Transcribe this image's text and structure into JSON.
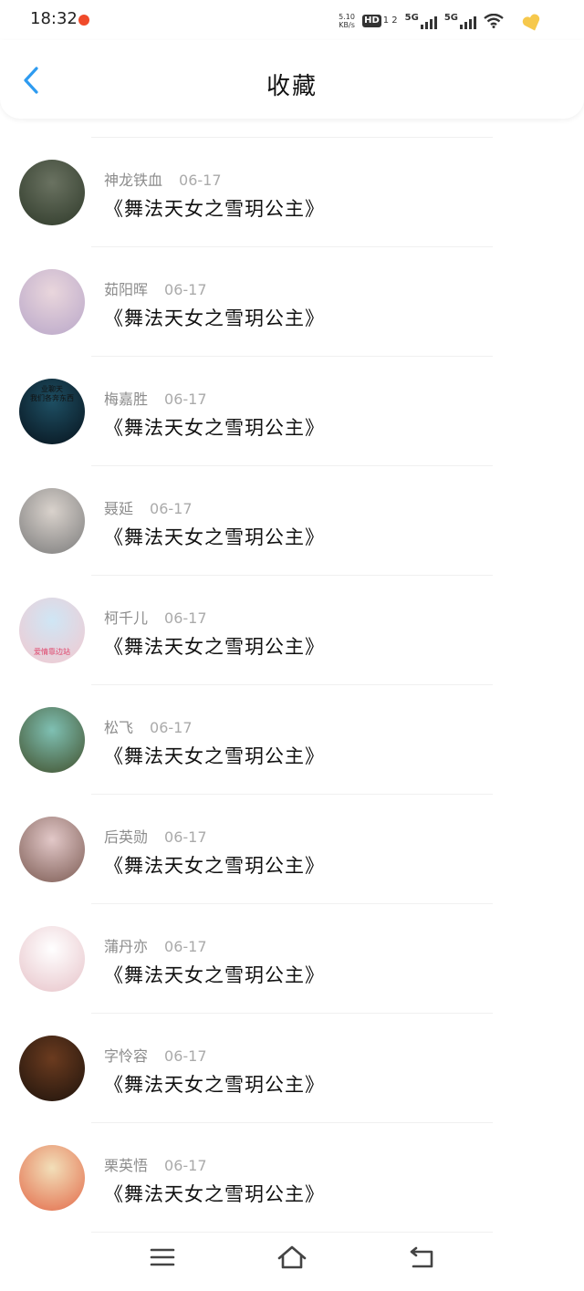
{
  "status_bar": {
    "time": "18:32",
    "net_speed_value": "5.10",
    "net_speed_unit": "KB/s",
    "hd_label": "HD",
    "hd_sub": "1 2",
    "signal1_label": "5G",
    "signal2_label": "5G"
  },
  "header": {
    "title": "收藏",
    "accent_color": "#2e9bf0"
  },
  "items": [
    {
      "user": "神龙铁血",
      "date": "06-17",
      "title": "《舞法天女之雪玥公主》",
      "avatar_colors": [
        "#6a7261",
        "#2f3a2a"
      ]
    },
    {
      "user": "茹阳晖",
      "date": "06-17",
      "title": "《舞法天女之雪玥公主》",
      "avatar_colors": [
        "#e9d6dc",
        "#b9a7c9"
      ]
    },
    {
      "user": "梅嘉胜",
      "date": "06-17",
      "title": "《舞法天女之雪玥公主》",
      "avatar_colors": [
        "#1e4f63",
        "#07131d"
      ],
      "avatar_text": [
        "业聊天",
        "我们各奔东西"
      ]
    },
    {
      "user": "聂延",
      "date": "06-17",
      "title": "《舞法天女之雪玥公主》",
      "avatar_colors": [
        "#d9d2cc",
        "#7c7c7c"
      ]
    },
    {
      "user": "柯千儿",
      "date": "06-17",
      "title": "《舞法天女之雪玥公主》",
      "avatar_colors": [
        "#cfe6f5",
        "#f2c8cf"
      ],
      "avatar_text": [
        "爱情靠边站"
      ]
    },
    {
      "user": "松飞",
      "date": "06-17",
      "title": "《舞法天女之雪玥公主》",
      "avatar_colors": [
        "#7fc0b3",
        "#41502c"
      ]
    },
    {
      "user": "后英勋",
      "date": "06-17",
      "title": "《舞法天女之雪玥公主》",
      "avatar_colors": [
        "#e2c8c8",
        "#7c5b53"
      ]
    },
    {
      "user": "蒲丹亦",
      "date": "06-17",
      "title": "《舞法天女之雪玥公主》",
      "avatar_colors": [
        "#ffffff",
        "#e7c3c9"
      ]
    },
    {
      "user": "字怜容",
      "date": "06-17",
      "title": "《舞法天女之雪玥公主》",
      "avatar_colors": [
        "#6b3b1f",
        "#1e130c"
      ]
    },
    {
      "user": "栗英悟",
      "date": "06-17",
      "title": "《舞法天女之雪玥公主》",
      "avatar_colors": [
        "#f2dfb9",
        "#e36b4a"
      ]
    }
  ],
  "navbar": {
    "menu_icon": "menu-icon",
    "home_icon": "home-icon",
    "back_icon": "return-icon"
  }
}
